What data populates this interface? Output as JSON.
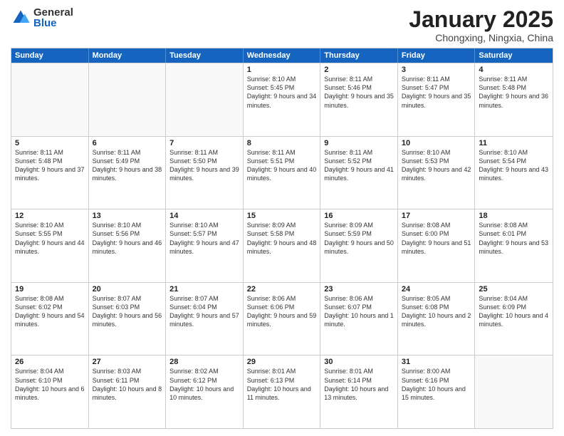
{
  "logo": {
    "general": "General",
    "blue": "Blue"
  },
  "title": "January 2025",
  "location": "Chongxing, Ningxia, China",
  "days_header": [
    "Sunday",
    "Monday",
    "Tuesday",
    "Wednesday",
    "Thursday",
    "Friday",
    "Saturday"
  ],
  "weeks": [
    [
      {
        "day": "",
        "sunrise": "",
        "sunset": "",
        "daylight": ""
      },
      {
        "day": "",
        "sunrise": "",
        "sunset": "",
        "daylight": ""
      },
      {
        "day": "",
        "sunrise": "",
        "sunset": "",
        "daylight": ""
      },
      {
        "day": "1",
        "sunrise": "Sunrise: 8:10 AM",
        "sunset": "Sunset: 5:45 PM",
        "daylight": "Daylight: 9 hours and 34 minutes."
      },
      {
        "day": "2",
        "sunrise": "Sunrise: 8:11 AM",
        "sunset": "Sunset: 5:46 PM",
        "daylight": "Daylight: 9 hours and 35 minutes."
      },
      {
        "day": "3",
        "sunrise": "Sunrise: 8:11 AM",
        "sunset": "Sunset: 5:47 PM",
        "daylight": "Daylight: 9 hours and 35 minutes."
      },
      {
        "day": "4",
        "sunrise": "Sunrise: 8:11 AM",
        "sunset": "Sunset: 5:48 PM",
        "daylight": "Daylight: 9 hours and 36 minutes."
      }
    ],
    [
      {
        "day": "5",
        "sunrise": "Sunrise: 8:11 AM",
        "sunset": "Sunset: 5:48 PM",
        "daylight": "Daylight: 9 hours and 37 minutes."
      },
      {
        "day": "6",
        "sunrise": "Sunrise: 8:11 AM",
        "sunset": "Sunset: 5:49 PM",
        "daylight": "Daylight: 9 hours and 38 minutes."
      },
      {
        "day": "7",
        "sunrise": "Sunrise: 8:11 AM",
        "sunset": "Sunset: 5:50 PM",
        "daylight": "Daylight: 9 hours and 39 minutes."
      },
      {
        "day": "8",
        "sunrise": "Sunrise: 8:11 AM",
        "sunset": "Sunset: 5:51 PM",
        "daylight": "Daylight: 9 hours and 40 minutes."
      },
      {
        "day": "9",
        "sunrise": "Sunrise: 8:11 AM",
        "sunset": "Sunset: 5:52 PM",
        "daylight": "Daylight: 9 hours and 41 minutes."
      },
      {
        "day": "10",
        "sunrise": "Sunrise: 8:10 AM",
        "sunset": "Sunset: 5:53 PM",
        "daylight": "Daylight: 9 hours and 42 minutes."
      },
      {
        "day": "11",
        "sunrise": "Sunrise: 8:10 AM",
        "sunset": "Sunset: 5:54 PM",
        "daylight": "Daylight: 9 hours and 43 minutes."
      }
    ],
    [
      {
        "day": "12",
        "sunrise": "Sunrise: 8:10 AM",
        "sunset": "Sunset: 5:55 PM",
        "daylight": "Daylight: 9 hours and 44 minutes."
      },
      {
        "day": "13",
        "sunrise": "Sunrise: 8:10 AM",
        "sunset": "Sunset: 5:56 PM",
        "daylight": "Daylight: 9 hours and 46 minutes."
      },
      {
        "day": "14",
        "sunrise": "Sunrise: 8:10 AM",
        "sunset": "Sunset: 5:57 PM",
        "daylight": "Daylight: 9 hours and 47 minutes."
      },
      {
        "day": "15",
        "sunrise": "Sunrise: 8:09 AM",
        "sunset": "Sunset: 5:58 PM",
        "daylight": "Daylight: 9 hours and 48 minutes."
      },
      {
        "day": "16",
        "sunrise": "Sunrise: 8:09 AM",
        "sunset": "Sunset: 5:59 PM",
        "daylight": "Daylight: 9 hours and 50 minutes."
      },
      {
        "day": "17",
        "sunrise": "Sunrise: 8:08 AM",
        "sunset": "Sunset: 6:00 PM",
        "daylight": "Daylight: 9 hours and 51 minutes."
      },
      {
        "day": "18",
        "sunrise": "Sunrise: 8:08 AM",
        "sunset": "Sunset: 6:01 PM",
        "daylight": "Daylight: 9 hours and 53 minutes."
      }
    ],
    [
      {
        "day": "19",
        "sunrise": "Sunrise: 8:08 AM",
        "sunset": "Sunset: 6:02 PM",
        "daylight": "Daylight: 9 hours and 54 minutes."
      },
      {
        "day": "20",
        "sunrise": "Sunrise: 8:07 AM",
        "sunset": "Sunset: 6:03 PM",
        "daylight": "Daylight: 9 hours and 56 minutes."
      },
      {
        "day": "21",
        "sunrise": "Sunrise: 8:07 AM",
        "sunset": "Sunset: 6:04 PM",
        "daylight": "Daylight: 9 hours and 57 minutes."
      },
      {
        "day": "22",
        "sunrise": "Sunrise: 8:06 AM",
        "sunset": "Sunset: 6:06 PM",
        "daylight": "Daylight: 9 hours and 59 minutes."
      },
      {
        "day": "23",
        "sunrise": "Sunrise: 8:06 AM",
        "sunset": "Sunset: 6:07 PM",
        "daylight": "Daylight: 10 hours and 1 minute."
      },
      {
        "day": "24",
        "sunrise": "Sunrise: 8:05 AM",
        "sunset": "Sunset: 6:08 PM",
        "daylight": "Daylight: 10 hours and 2 minutes."
      },
      {
        "day": "25",
        "sunrise": "Sunrise: 8:04 AM",
        "sunset": "Sunset: 6:09 PM",
        "daylight": "Daylight: 10 hours and 4 minutes."
      }
    ],
    [
      {
        "day": "26",
        "sunrise": "Sunrise: 8:04 AM",
        "sunset": "Sunset: 6:10 PM",
        "daylight": "Daylight: 10 hours and 6 minutes."
      },
      {
        "day": "27",
        "sunrise": "Sunrise: 8:03 AM",
        "sunset": "Sunset: 6:11 PM",
        "daylight": "Daylight: 10 hours and 8 minutes."
      },
      {
        "day": "28",
        "sunrise": "Sunrise: 8:02 AM",
        "sunset": "Sunset: 6:12 PM",
        "daylight": "Daylight: 10 hours and 10 minutes."
      },
      {
        "day": "29",
        "sunrise": "Sunrise: 8:01 AM",
        "sunset": "Sunset: 6:13 PM",
        "daylight": "Daylight: 10 hours and 11 minutes."
      },
      {
        "day": "30",
        "sunrise": "Sunrise: 8:01 AM",
        "sunset": "Sunset: 6:14 PM",
        "daylight": "Daylight: 10 hours and 13 minutes."
      },
      {
        "day": "31",
        "sunrise": "Sunrise: 8:00 AM",
        "sunset": "Sunset: 6:16 PM",
        "daylight": "Daylight: 10 hours and 15 minutes."
      },
      {
        "day": "",
        "sunrise": "",
        "sunset": "",
        "daylight": ""
      }
    ]
  ]
}
